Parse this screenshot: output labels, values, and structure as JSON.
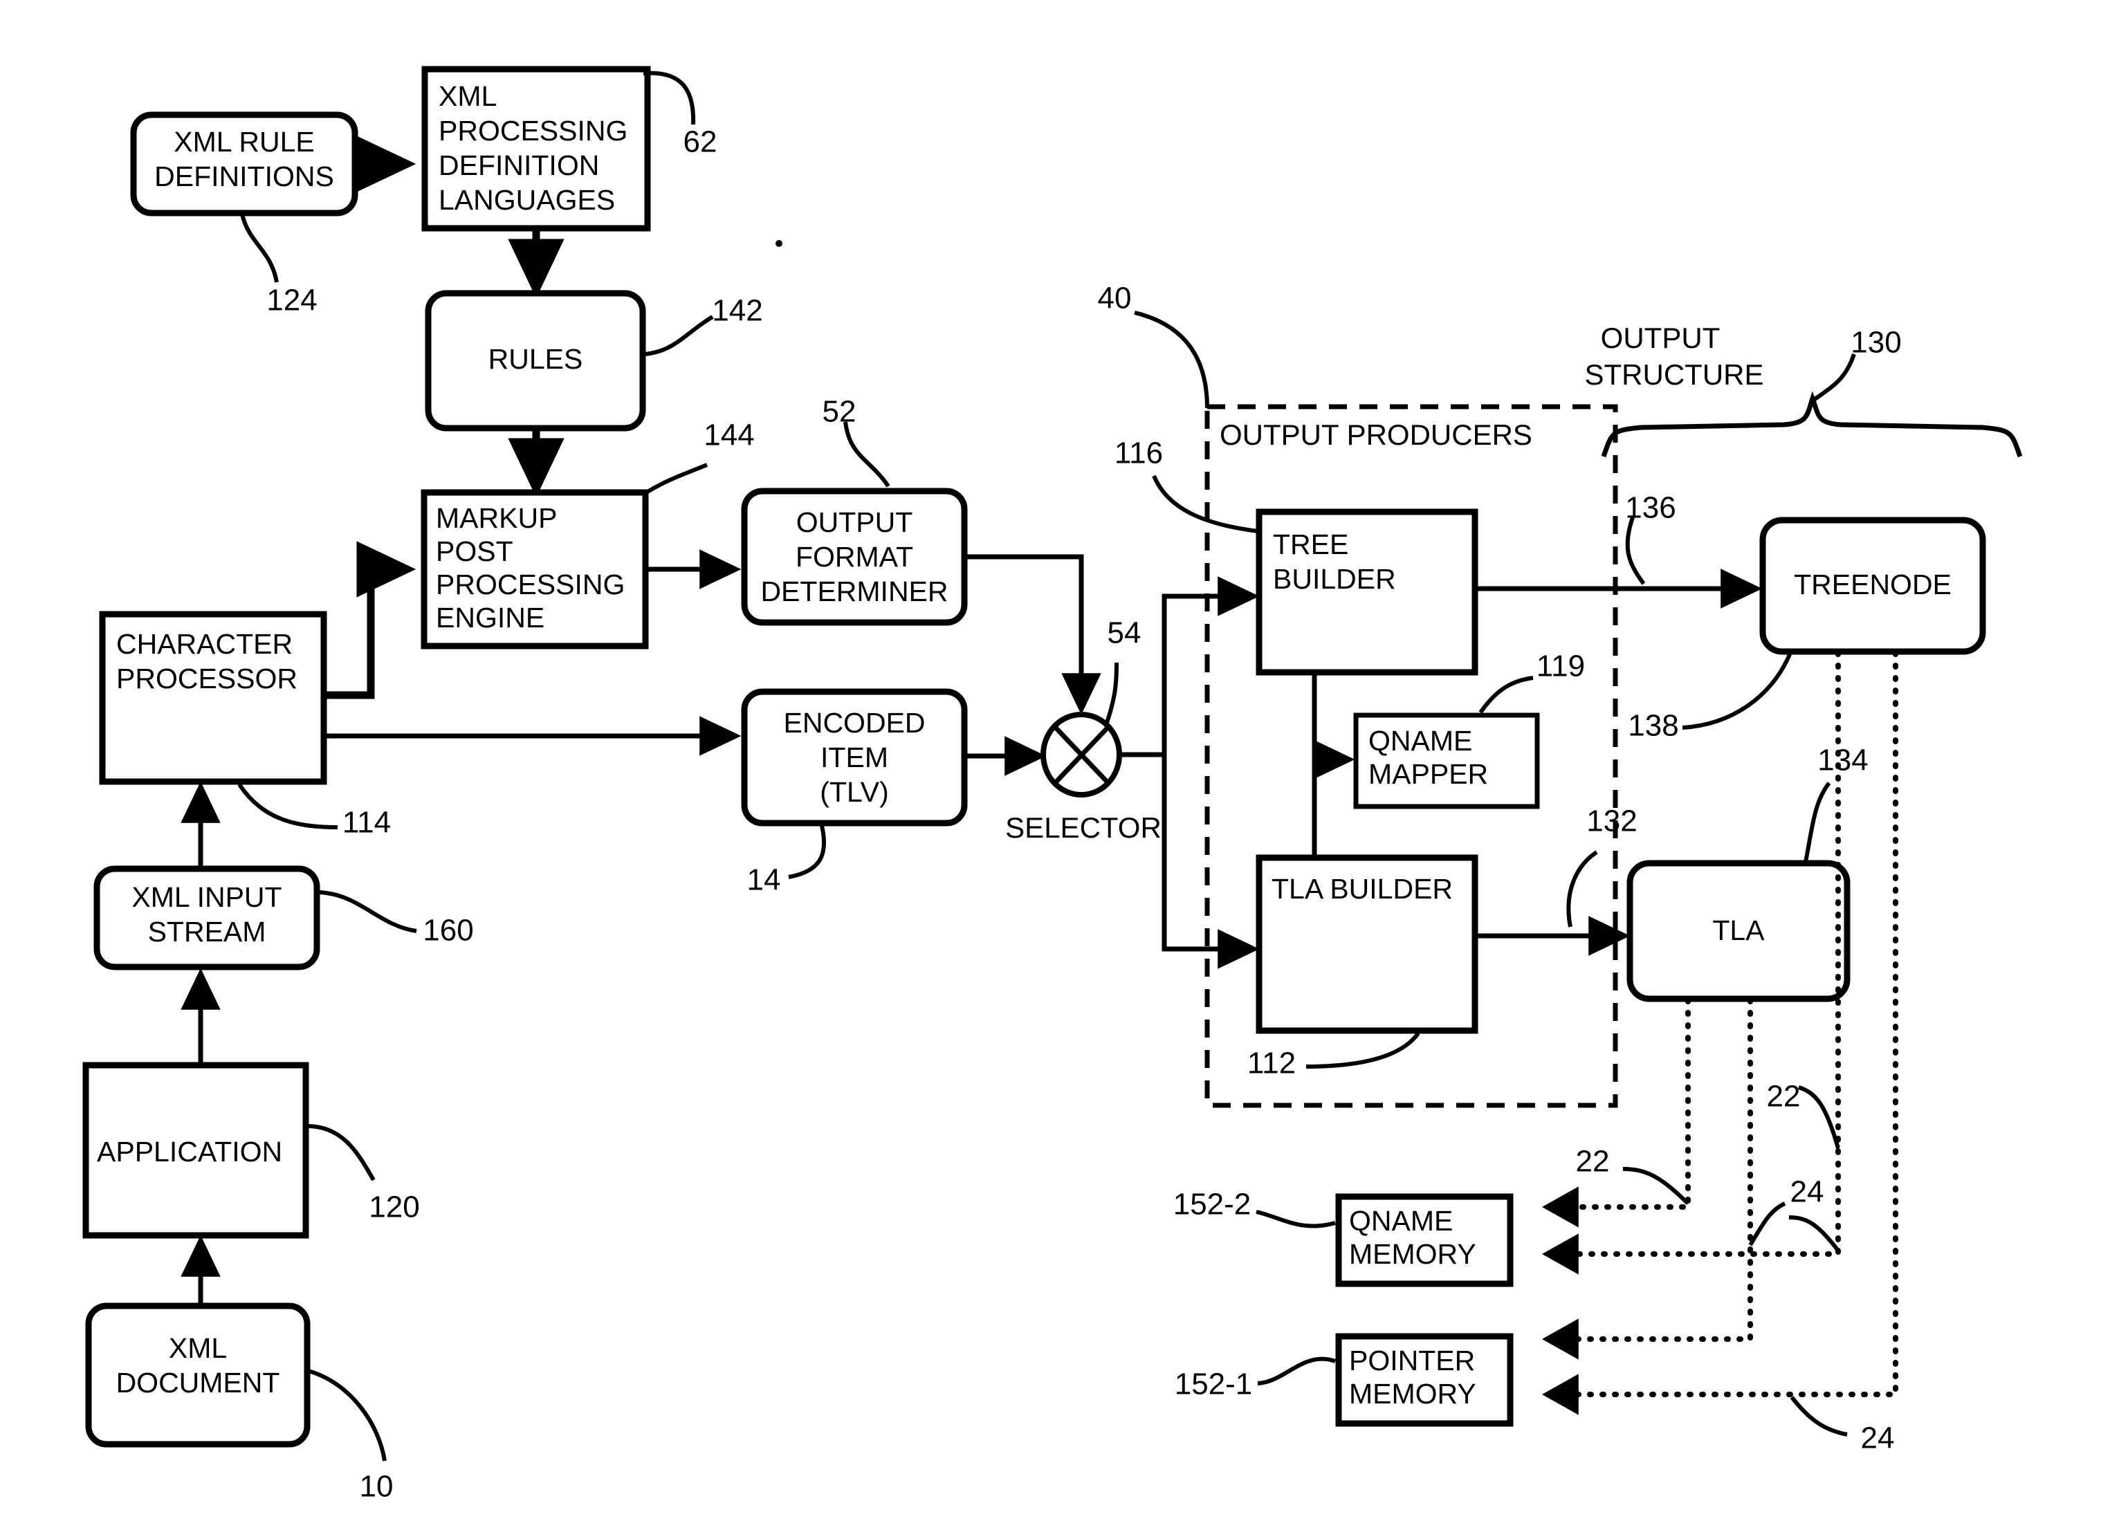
{
  "figure": {
    "title": "XML processing system block diagram",
    "background": "#ffffff",
    "ink": "#000000"
  },
  "boxes": {
    "xml_rule_definitions": {
      "line1": "XML RULE",
      "line2": "DEFINITIONS",
      "ref": "124"
    },
    "xml_processing_definition_languages": {
      "line1": "XML",
      "line2": "PROCESSING",
      "line3": "DEFINITION",
      "line4": "LANGUAGES",
      "ref": "62"
    },
    "rules": {
      "line1": "RULES",
      "ref": "142"
    },
    "markup_post_processing_engine": {
      "line1": "MARKUP",
      "line2": "POST",
      "line3": "PROCESSING",
      "line4": "ENGINE",
      "ref": "144"
    },
    "character_processor": {
      "line1": "CHARACTER",
      "line2": "PROCESSOR",
      "ref": "114"
    },
    "xml_input_stream": {
      "line1": "XML INPUT",
      "line2": "STREAM",
      "ref": "160"
    },
    "application": {
      "line1": "APPLICATION",
      "ref": "120"
    },
    "xml_document": {
      "line1": "XML",
      "line2": "DOCUMENT",
      "ref": "10"
    },
    "output_format_determiner": {
      "line1": "OUTPUT",
      "line2": "FORMAT",
      "line3": "DETERMINER",
      "ref": "52"
    },
    "encoded_item": {
      "line1": "ENCODED",
      "line2": "ITEM",
      "line3": "(TLV)",
      "ref": "14"
    },
    "selector": {
      "label": "SELECTOR",
      "ref": "54"
    },
    "tree_builder": {
      "line1": "TREE",
      "line2": "BUILDER",
      "ref": "116"
    },
    "qname_mapper": {
      "line1": "QNAME",
      "line2": "MAPPER",
      "ref": "119"
    },
    "tla_builder": {
      "line1": "TLA BUILDER",
      "ref": "112"
    },
    "treenode": {
      "line1": "TREENODE",
      "ref": "136",
      "ref2": "138"
    },
    "tla": {
      "line1": "TLA",
      "ref": "132",
      "ref2": "134"
    },
    "qname_memory": {
      "line1": "QNAME",
      "line2": "MEMORY",
      "ref": "152-2"
    },
    "pointer_memory": {
      "line1": "POINTER",
      "line2": "MEMORY",
      "ref": "152-1"
    }
  },
  "groups": {
    "output_producers": {
      "label": "OUTPUT PRODUCERS",
      "ref": "40"
    },
    "output_structure": {
      "line1": "OUTPUT",
      "line2": "STRUCTURE",
      "ref": "130"
    }
  },
  "connector_refs": {
    "dotted_22_left": "22",
    "dotted_22_right": "22",
    "dotted_24_upper": "24",
    "dotted_24_lower": "24"
  }
}
